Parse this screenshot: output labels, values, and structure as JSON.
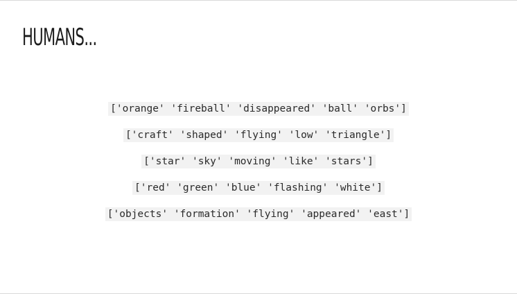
{
  "slide": {
    "title": "HUMANS...",
    "code_lines": [
      "['orange' 'fireball' 'disappeared' 'ball' 'orbs']",
      "['craft' 'shaped' 'flying' 'low' 'triangle']",
      "['star' 'sky' 'moving' 'like' 'stars']",
      "['red' 'green' 'blue' 'flashing' 'white']",
      "['objects' 'formation' 'flying' 'appeared' 'east']"
    ]
  }
}
